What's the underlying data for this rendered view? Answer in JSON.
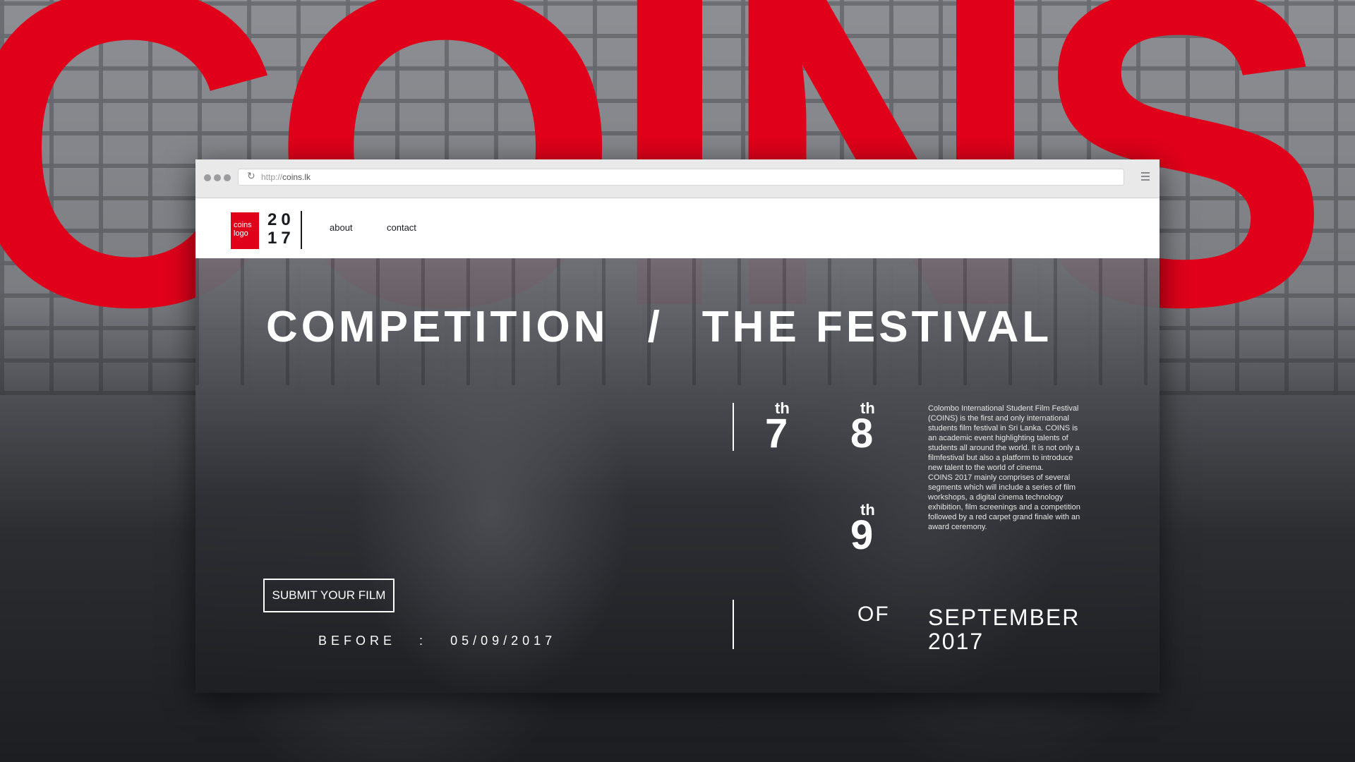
{
  "background": {
    "big_word": "COINS",
    "accent_color": "#e1001a"
  },
  "browser": {
    "url_prefix": "http://",
    "url_domain": "coins.lk",
    "reload_icon": "reload-icon",
    "menu_icon": "hamburger-menu-icon"
  },
  "header": {
    "logo_text_line1": "coins",
    "logo_text_line2": "logo",
    "year_top": "20",
    "year_bottom": "17",
    "nav": [
      {
        "label": "about"
      },
      {
        "label": "contact"
      }
    ]
  },
  "hero": {
    "title_left": "COMPETITION",
    "title_sep": "/",
    "title_right": "THE FESTIVAL",
    "dates": [
      {
        "day": "7",
        "suffix": "th"
      },
      {
        "day": "8",
        "suffix": "th"
      },
      {
        "day": "9",
        "suffix": "th"
      }
    ],
    "description": [
      "Colombo International Student Film Festival (COINS) is the first and only international students film festival in Sri Lanka. COINS is an academic event highlighting talents of students all around the world. It is not only a filmfestival but also a platform to introduce new talent to the world of cinema.",
      "COINS 2017 mainly comprises of several segments which will include a series of film workshops, a digital cinema technology exhibition, film screenings and a competition followed by a red carpet grand finale with an award ceremony."
    ],
    "of_label": "OF",
    "month": "SEPTEMBER",
    "year": "2017",
    "submit_label": "SUBMIT YOUR FILM",
    "before_label": "BEFORE",
    "before_sep": ":",
    "before_date": "05/09/2017"
  }
}
